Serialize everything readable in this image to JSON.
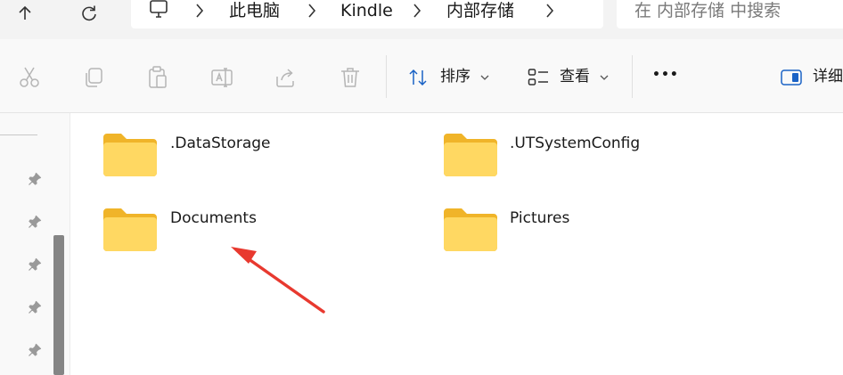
{
  "address_bar": {
    "breadcrumbs": [
      "此电脑",
      "Kindle",
      "内部存储"
    ],
    "search_placeholder": "在 内部存储 中搜索"
  },
  "toolbar": {
    "sort_label": "排序",
    "view_label": "查看",
    "more_label": "•••",
    "details_label": "详细"
  },
  "folders": [
    {
      "name": ".DataStorage"
    },
    {
      "name": ".UTSystemConfig"
    },
    {
      "name": "Documents"
    },
    {
      "name": "Pictures"
    }
  ],
  "colors": {
    "folder_back": "#f0b429",
    "folder_front": "#ffd862",
    "annotation_arrow": "#e8392f"
  },
  "icons": [
    "up-arrow-icon",
    "refresh-icon",
    "computer-icon",
    "chevron-right-icon",
    "cut-icon",
    "copy-icon",
    "paste-icon",
    "rename-icon",
    "share-icon",
    "delete-icon",
    "sort-icon",
    "view-icon",
    "chevron-down-icon",
    "more-icon",
    "details-pane-icon",
    "pin-icon",
    "folder-icon",
    "annotation-arrow"
  ]
}
